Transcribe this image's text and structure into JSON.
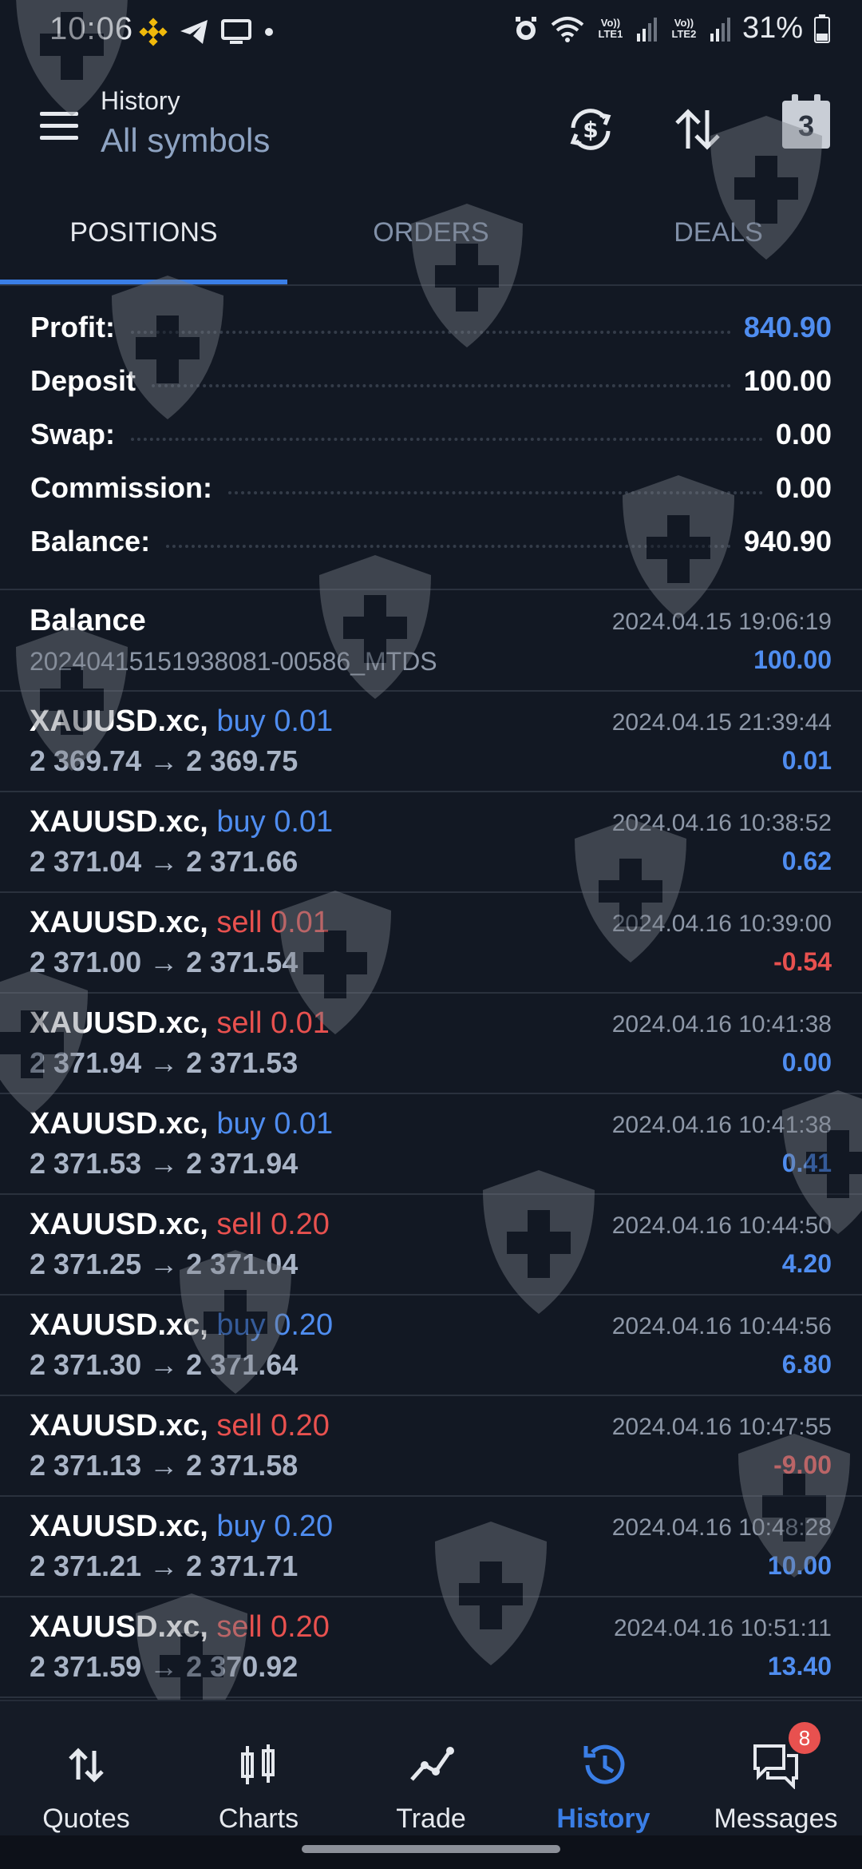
{
  "status_bar": {
    "time": "10:06",
    "battery": "31%",
    "sim1": "Vo)) LTE1",
    "sim2": "Vo)) LTE2"
  },
  "header": {
    "subtitle": "History",
    "title": "All symbols",
    "calendar_day": "3"
  },
  "tabs": [
    "POSITIONS",
    "ORDERS",
    "DEALS"
  ],
  "summary": [
    {
      "label": "Profit:",
      "value": "840.90"
    },
    {
      "label": "Deposit",
      "value": "100.00"
    },
    {
      "label": "Swap:",
      "value": "0.00"
    },
    {
      "label": "Commission:",
      "value": "0.00"
    },
    {
      "label": "Balance:",
      "value": "940.90"
    }
  ],
  "balance_entry": {
    "title": "Balance",
    "comment": "20240415151938081-00586_MTDS",
    "date": "2024.04.15 19:06:19",
    "amount": "100.00"
  },
  "positions": [
    {
      "symbol": "XAUUSD.xc,",
      "side": "buy 0.01",
      "prices": "2 369.74 → 2 369.75",
      "date": "2024.04.15 21:39:44",
      "profit": "0.01"
    },
    {
      "symbol": "XAUUSD.xc,",
      "side": "buy 0.01",
      "prices": "2 371.04 → 2 371.66",
      "date": "2024.04.16 10:38:52",
      "profit": "0.62"
    },
    {
      "symbol": "XAUUSD.xc,",
      "side": "sell 0.01",
      "prices": "2 371.00 → 2 371.54",
      "date": "2024.04.16 10:39:00",
      "profit": "-0.54"
    },
    {
      "symbol": "XAUUSD.xc,",
      "side": "sell 0.01",
      "prices": "2 371.94 → 2 371.53",
      "date": "2024.04.16 10:41:38",
      "profit": "0.00"
    },
    {
      "symbol": "XAUUSD.xc,",
      "side": "buy 0.01",
      "prices": "2 371.53 → 2 371.94",
      "date": "2024.04.16 10:41:38",
      "profit": "0.41"
    },
    {
      "symbol": "XAUUSD.xc,",
      "side": "sell 0.20",
      "prices": "2 371.25 → 2 371.04",
      "date": "2024.04.16 10:44:50",
      "profit": "4.20"
    },
    {
      "symbol": "XAUUSD.xc,",
      "side": "buy 0.20",
      "prices": "2 371.30 → 2 371.64",
      "date": "2024.04.16 10:44:56",
      "profit": "6.80"
    },
    {
      "symbol": "XAUUSD.xc,",
      "side": "sell 0.20",
      "prices": "2 371.13 → 2 371.58",
      "date": "2024.04.16 10:47:55",
      "profit": "-9.00"
    },
    {
      "symbol": "XAUUSD.xc,",
      "side": "buy 0.20",
      "prices": "2 371.21 → 2 371.71",
      "date": "2024.04.16 10:48:28",
      "profit": "10.00"
    },
    {
      "symbol": "XAUUSD.xc,",
      "side": "sell 0.20",
      "prices": "2 371.59 → 2 370.92",
      "date": "2024.04.16 10:51:11",
      "profit": "13.40"
    }
  ],
  "bottom_nav": [
    {
      "label": "Quotes",
      "icon": "quotes-icon"
    },
    {
      "label": "Charts",
      "icon": "charts-icon"
    },
    {
      "label": "Trade",
      "icon": "trade-icon"
    },
    {
      "label": "History",
      "icon": "history-icon"
    },
    {
      "label": "Messages",
      "icon": "messages-icon",
      "badge": "8"
    }
  ],
  "colors": {
    "background": "#121823",
    "accent_blue": "#4f8df0",
    "sell_red": "#e8514f",
    "tab_active_underline": "#3a7ee6"
  }
}
